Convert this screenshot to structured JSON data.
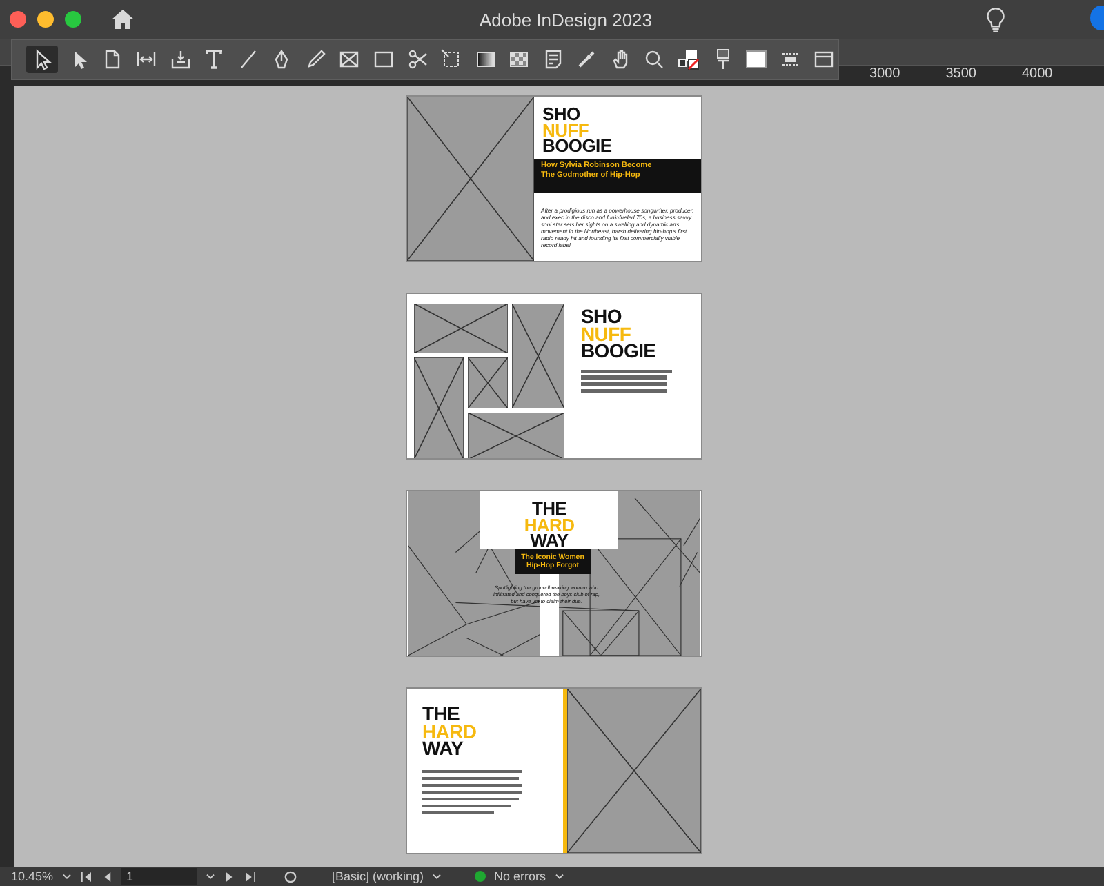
{
  "window": {
    "title": "Adobe InDesign 2023"
  },
  "toolbar": {
    "tools": [
      {
        "kind": "selection",
        "selected": true
      },
      {
        "kind": "direct",
        "selected": false
      },
      {
        "kind": "page",
        "selected": false
      },
      {
        "kind": "gap",
        "selected": false
      },
      {
        "kind": "collector",
        "selected": false
      },
      {
        "kind": "type",
        "selected": false
      },
      {
        "kind": "line",
        "selected": false
      },
      {
        "kind": "pen",
        "selected": false
      },
      {
        "kind": "pencil",
        "selected": false
      },
      {
        "kind": "frame",
        "selected": false
      },
      {
        "kind": "rectangle",
        "selected": false
      },
      {
        "kind": "scissors",
        "selected": false
      },
      {
        "kind": "transform",
        "selected": false
      },
      {
        "kind": "gradient",
        "selected": false
      },
      {
        "kind": "feather",
        "selected": false
      },
      {
        "kind": "note",
        "selected": false
      },
      {
        "kind": "eyedropper",
        "selected": false
      },
      {
        "kind": "hand",
        "selected": false
      },
      {
        "kind": "zoom",
        "selected": false
      },
      {
        "kind": "swatches",
        "selected": false
      },
      {
        "kind": "format",
        "selected": false
      },
      {
        "kind": "fill",
        "selected": false
      },
      {
        "kind": "frames",
        "selected": false
      },
      {
        "kind": "screen",
        "selected": false
      }
    ]
  },
  "ruler": {
    "labels": [
      "3000",
      "3500",
      "4000"
    ]
  },
  "spreads": [
    {
      "kind": "feature",
      "title_lines": [
        {
          "text": "SHO",
          "accent": false
        },
        {
          "text": "NUFF",
          "accent": true
        },
        {
          "text": "BOOGIE",
          "accent": false
        }
      ],
      "subtitle": "How Sylvia Robinson Become The Godmother of Hip-Hop",
      "body": "After a prodigious run as a powerhouse songwriter, producer, and exec in the disco and funk-fueled 70s, a business savvy soul star sets her sights on a swelling and dynamic arts movement in the Northeast, harsh delivering hip-hop's first radio ready hit and founding its first commercially viable record label."
    },
    {
      "kind": "collage",
      "title_lines": [
        {
          "text": "SHO",
          "accent": false
        },
        {
          "text": "NUFF",
          "accent": true
        },
        {
          "text": "BOOGIE",
          "accent": false
        }
      ]
    },
    {
      "kind": "overlay",
      "title_lines": [
        {
          "text": "THE",
          "accent": false
        },
        {
          "text": "HARD",
          "accent": true
        },
        {
          "text": "WAY",
          "accent": false
        }
      ],
      "subtitle": "The Iconic Women Hip-Hop Forgot",
      "body": "Spotlighting the groundbreaking women who infiltrated and conquered the boys club of rap, but have yet to claim their due."
    },
    {
      "kind": "split",
      "title_lines": [
        {
          "text": "THE",
          "accent": false
        },
        {
          "text": "HARD",
          "accent": true
        },
        {
          "text": "WAY",
          "accent": false
        }
      ]
    }
  ],
  "status_bar": {
    "zoom": "10.45%",
    "page": "1",
    "profile": "[Basic] (working)",
    "preflight": "No errors",
    "preflight_ok": true
  }
}
